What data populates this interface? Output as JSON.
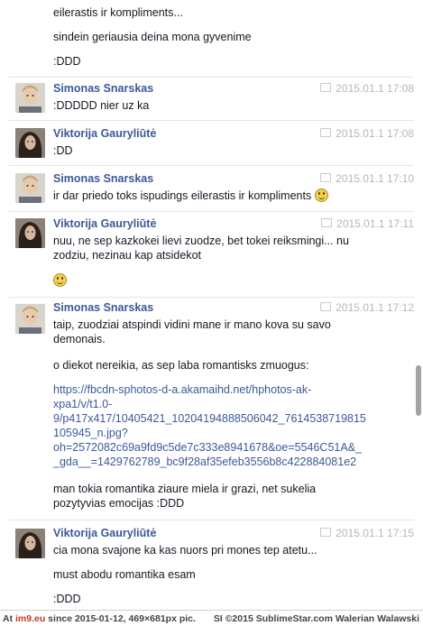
{
  "top_lines": [
    "eilerastis ir kompliments...",
    "sindein geriausia deina mona gyvenime",
    ":DDD"
  ],
  "messages": [
    {
      "author": "Simonas Snarskas",
      "time": "2015.01.1 17:08",
      "lines": [
        ":DDDDD nier uz ka"
      ]
    },
    {
      "author": "Viktorija Gauryliūtė",
      "time": "2015.01.1 17:08",
      "lines": [
        ":DD"
      ]
    },
    {
      "author": "Simonas Snarskas",
      "time": "2015.01.1 17:10",
      "lines": [
        "ir dar priedo toks ispudings eilerastis ir kompliments"
      ]
    },
    {
      "author": "Viktorija Gauryliūtė",
      "time": "2015.01.1 17:11",
      "lines": [
        "nuu, ne sep kazkokei lievi zuodze, bet  tokei reiksmingi... nu zodziu, nezinau kap atsidekot"
      ]
    },
    {
      "author": "Simonas Snarskas",
      "time": "2015.01.1 17:12",
      "lines": [
        "taip, zuodziai atspindi vidini mane ir mano kova su savo demonais.",
        "o diekot nereikia, as sep laba romantisks zmuogus:",
        "https://fbcdn-sphotos-d-a.akamaihd.net/hphotos-ak-xpa1/v/t1.0-9/p417x417/10405421_10204194888506042_7614538719815105945_n.jpg?oh=2572082c69a9fd9c5de7c333e8941678&oe=5546C51A&__gda__=1429762789_bc9f28af35efeb3556b8c422884081e2",
        "man tokia romantika ziaure miela ir grazi, net sukelia pozytyvias emocijas :DDD"
      ]
    },
    {
      "author": "Viktorija Gauryliūtė",
      "time": "2015.01.1 17:15",
      "lines": [
        "cia mona svajone ka kas nuors pri mones tep atetu...",
        "must abodu romantika esam",
        ":DDD"
      ]
    }
  ],
  "link_parts": [
    "https://fbcdn-sphotos-d-a.akamaihd.net/hphotos-ak-",
    "xpa1/v/t1.0-",
    "9/p417x417/10405421_10204194888506042_7614538719815",
    "105945_n.jpg?",
    "oh=2572082c69a9fd9c5de7c333e8941678&oe=5546C51A&_",
    "_gda__=1429762789_bc9f28af35efeb3556b8c422884081e2"
  ],
  "line_parts": {
    "v4_1": "nuu, ne sep kazkokei lievi zuodze, bet  tokei reiksmingi... nu",
    "v4_2": "zodziu, nezinau kap atsidekot",
    "s5_1a": "taip, zuodziai atspindi vidini mane ir mano kova su savo",
    "s5_1b": "demonais.",
    "s5_4a": "man tokia romantika ziaure miela ir grazi, net sukelia",
    "s5_4b": "pozytyvias emocijas :DDD"
  },
  "footer": {
    "prefix": "At ",
    "site": "im9.eu",
    "left_rest": " since 2015-01-12, 469×681px pic.",
    "right": "SI ©2015 SublimeStar.com Walerian Walawski"
  },
  "colors": {
    "name": "#3b5998",
    "link": "#3b5998",
    "time": "#b5b7bc",
    "text": "#141823"
  },
  "icons": [
    "chat-bubble-icon",
    "smiley-icon"
  ]
}
